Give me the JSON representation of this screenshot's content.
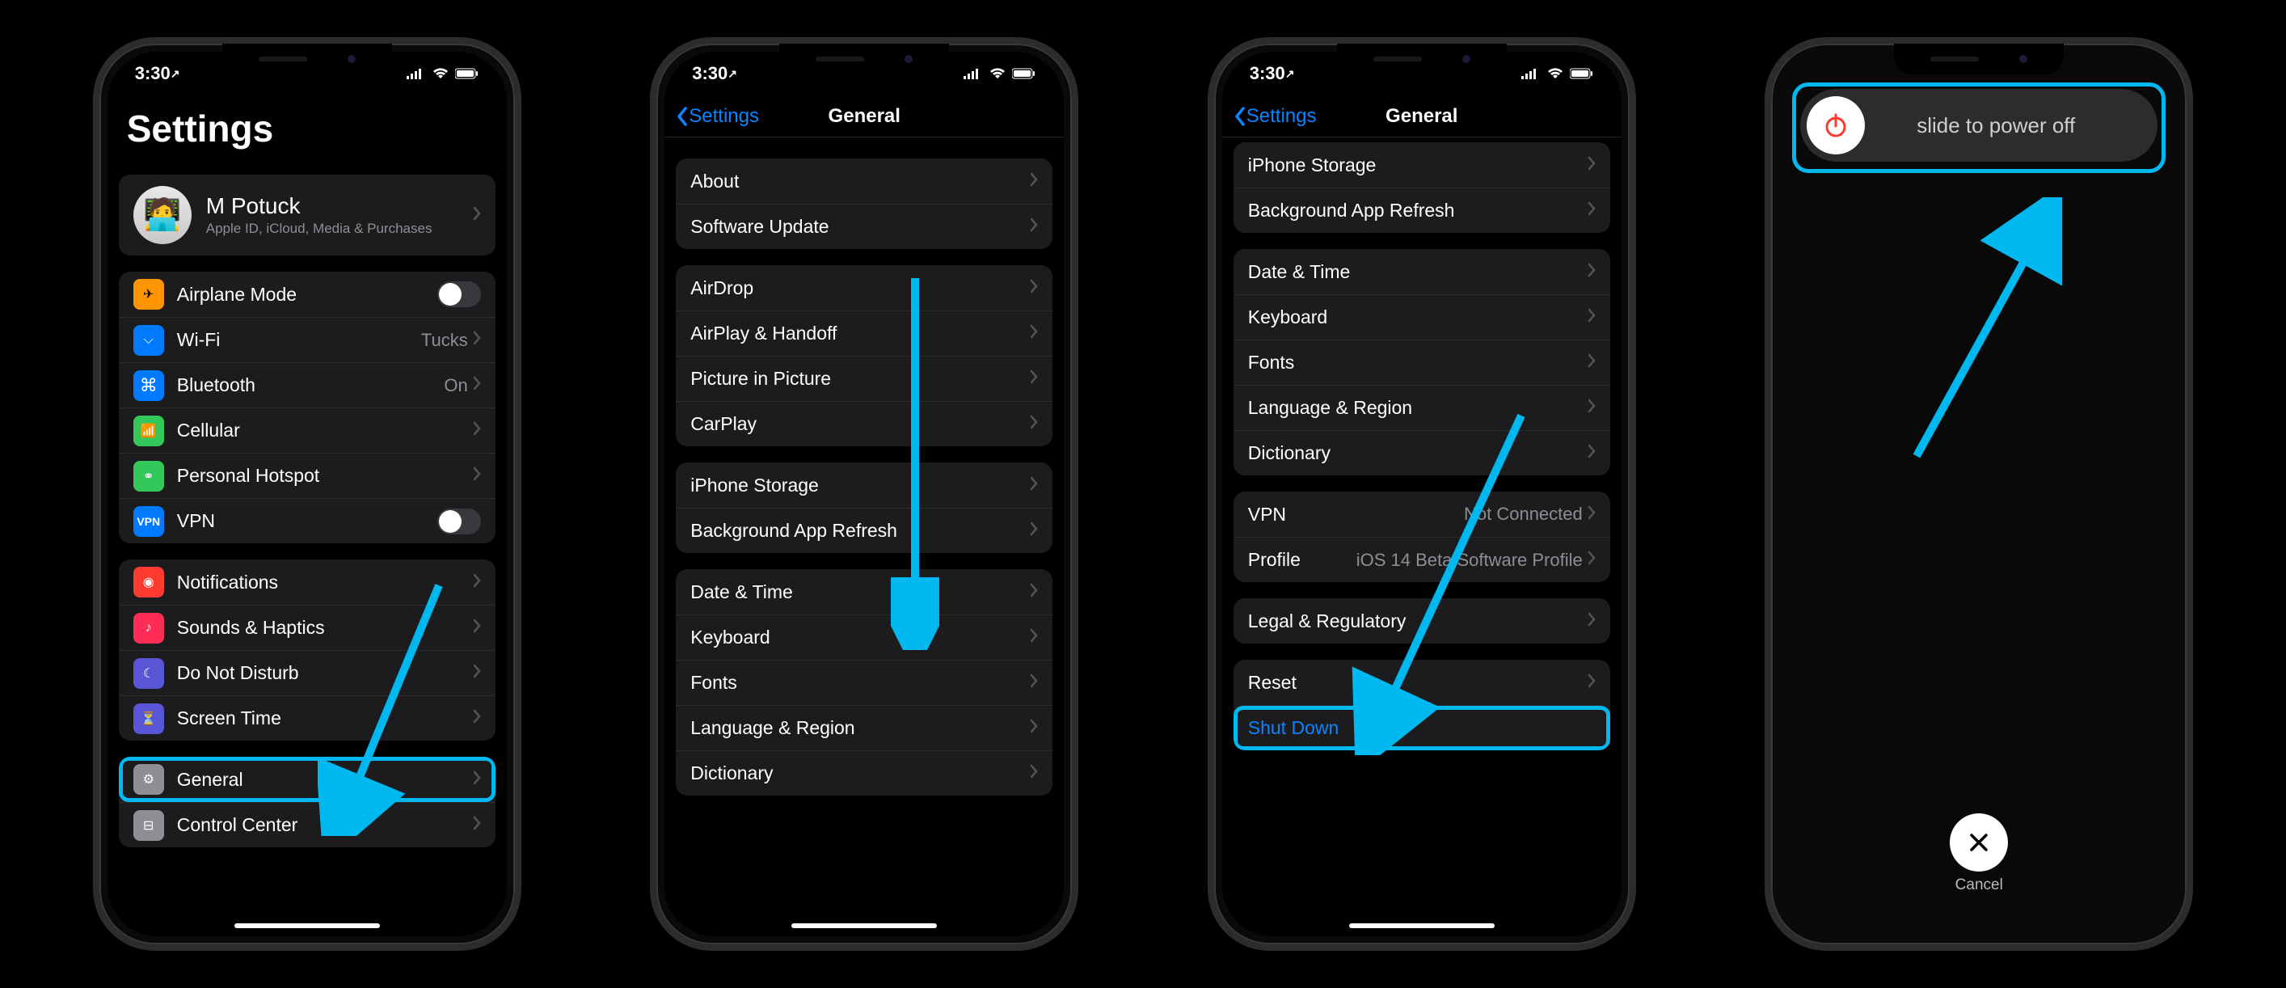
{
  "statusbar": {
    "time": "3:30"
  },
  "screen1": {
    "title": "Settings",
    "profile": {
      "name": "M Potuck",
      "sub": "Apple ID, iCloud, Media & Purchases"
    },
    "network": {
      "airplane": "Airplane Mode",
      "wifi": "Wi-Fi",
      "wifi_value": "Tucks",
      "bluetooth": "Bluetooth",
      "bluetooth_value": "On",
      "cellular": "Cellular",
      "hotspot": "Personal Hotspot",
      "vpn": "VPN"
    },
    "misc": {
      "notifications": "Notifications",
      "sounds": "Sounds & Haptics",
      "dnd": "Do Not Disturb",
      "screentime": "Screen Time"
    },
    "general_group": {
      "general": "General",
      "controlcenter": "Control Center"
    }
  },
  "screen2": {
    "back": "Settings",
    "title": "General",
    "g1": {
      "about": "About",
      "sw": "Software Update"
    },
    "g2": {
      "airdrop": "AirDrop",
      "airplay": "AirPlay & Handoff",
      "pip": "Picture in Picture",
      "carplay": "CarPlay"
    },
    "g3": {
      "storage": "iPhone Storage",
      "bgrefresh": "Background App Refresh"
    },
    "g4": {
      "datetime": "Date & Time",
      "keyboard": "Keyboard",
      "fonts": "Fonts",
      "lang": "Language & Region",
      "dict": "Dictionary"
    }
  },
  "screen3": {
    "back": "Settings",
    "title": "General",
    "g1": {
      "storage": "iPhone Storage",
      "bgrefresh": "Background App Refresh"
    },
    "g2": {
      "datetime": "Date & Time",
      "keyboard": "Keyboard",
      "fonts": "Fonts",
      "lang": "Language & Region",
      "dict": "Dictionary"
    },
    "g3": {
      "vpn": "VPN",
      "vpn_val": "Not Connected",
      "profile": "Profile",
      "profile_val": "iOS 14 Beta Software Profile"
    },
    "g4": {
      "legal": "Legal & Regulatory"
    },
    "g5": {
      "reset": "Reset",
      "shutdown": "Shut Down"
    }
  },
  "screen4": {
    "slide_text": "slide to power off",
    "cancel": "Cancel"
  }
}
